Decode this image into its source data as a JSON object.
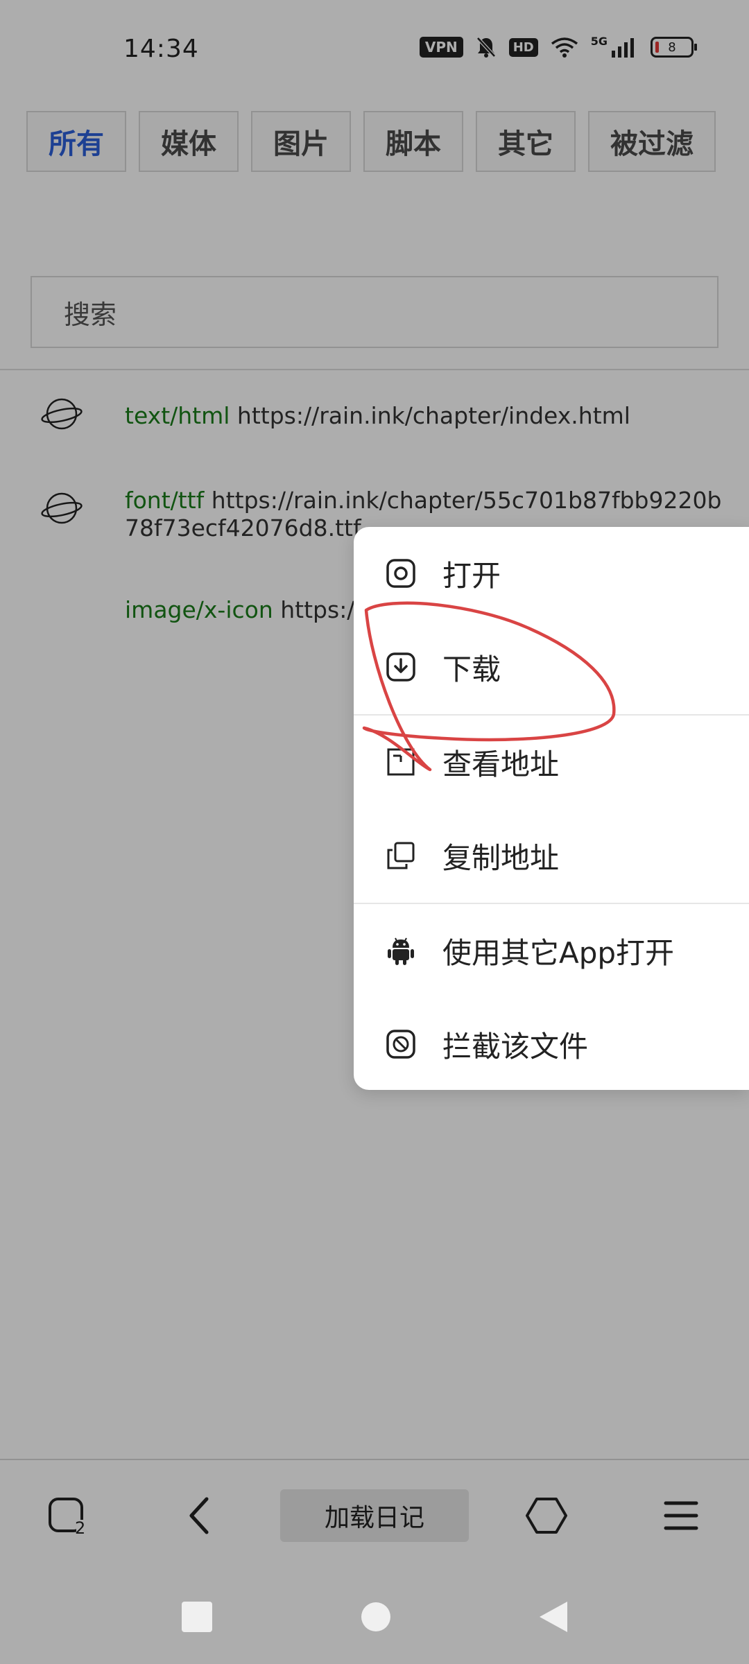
{
  "status_bar": {
    "time": "14:34",
    "vpn_label": "VPN",
    "hd_label": "HD",
    "network_label": "5G",
    "battery_level": "8"
  },
  "filter_tabs": [
    {
      "label": "所有",
      "active": true
    },
    {
      "label": "媒体",
      "active": false
    },
    {
      "label": "图片",
      "active": false
    },
    {
      "label": "脚本",
      "active": false
    },
    {
      "label": "其它",
      "active": false
    },
    {
      "label": "被过滤",
      "active": false
    }
  ],
  "search": {
    "placeholder": "搜索"
  },
  "resources": [
    {
      "mime": "text/html",
      "url": " https://rain.ink/chapter/index.html",
      "icon": "planet-icon"
    },
    {
      "mime": "font/ttf",
      "url": " https://rain.ink/chapter/55c701b87fbb9220b78f73ecf42076d8.ttf",
      "icon": "planet-icon"
    },
    {
      "mime": "image/x-icon",
      "url": " https:/",
      "icon": ""
    }
  ],
  "context_menu": {
    "items": [
      {
        "label": "打开",
        "icon": "open-icon"
      },
      {
        "label": "下载",
        "icon": "download-icon"
      },
      {
        "label": "查看地址",
        "icon": "view-address-icon"
      },
      {
        "label": "复制地址",
        "icon": "copy-icon"
      },
      {
        "label": "使用其它App打开",
        "icon": "android-icon"
      },
      {
        "label": "拦截该文件",
        "icon": "block-icon"
      }
    ]
  },
  "toolbar": {
    "tabs_count": "2",
    "log_button_label": "加载日记"
  },
  "colors": {
    "active_tab": "#2b5fd9",
    "mime_type": "#1a7d1a",
    "overlay": "rgba(0,0,0,0.32)",
    "annotation": "#d94444"
  }
}
